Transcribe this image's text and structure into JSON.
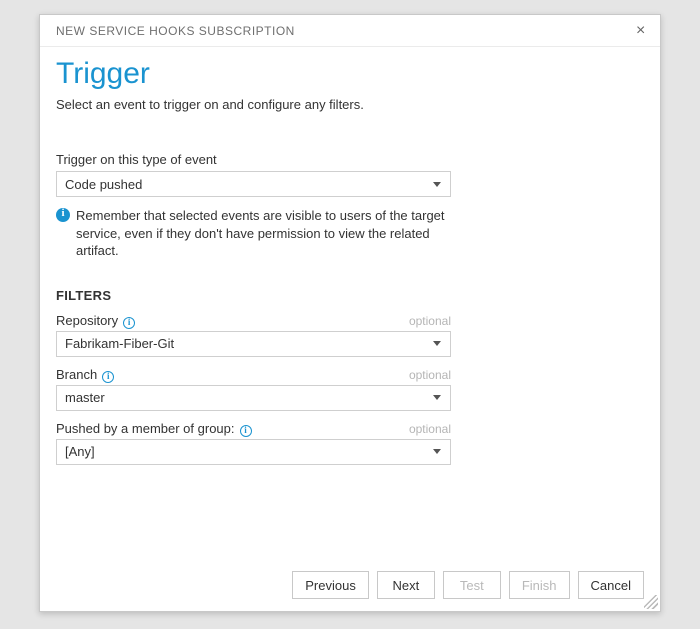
{
  "dialog": {
    "title": "NEW SERVICE HOOKS SUBSCRIPTION"
  },
  "page": {
    "heading": "Trigger",
    "subtitle": "Select an event to trigger on and configure any filters."
  },
  "trigger": {
    "label": "Trigger on this type of event",
    "value": "Code pushed",
    "info": "Remember that selected events are visible to users of the target service, even if they don't have permission to view the related artifact."
  },
  "filters": {
    "heading": "FILTERS",
    "items": [
      {
        "label": "Repository",
        "value": "Fabrikam-Fiber-Git",
        "optional": "optional"
      },
      {
        "label": "Branch",
        "value": "master",
        "optional": "optional"
      },
      {
        "label": "Pushed by a member of group:",
        "value": "[Any]",
        "optional": "optional"
      }
    ]
  },
  "buttons": {
    "previous": "Previous",
    "next": "Next",
    "test": "Test",
    "finish": "Finish",
    "cancel": "Cancel"
  }
}
